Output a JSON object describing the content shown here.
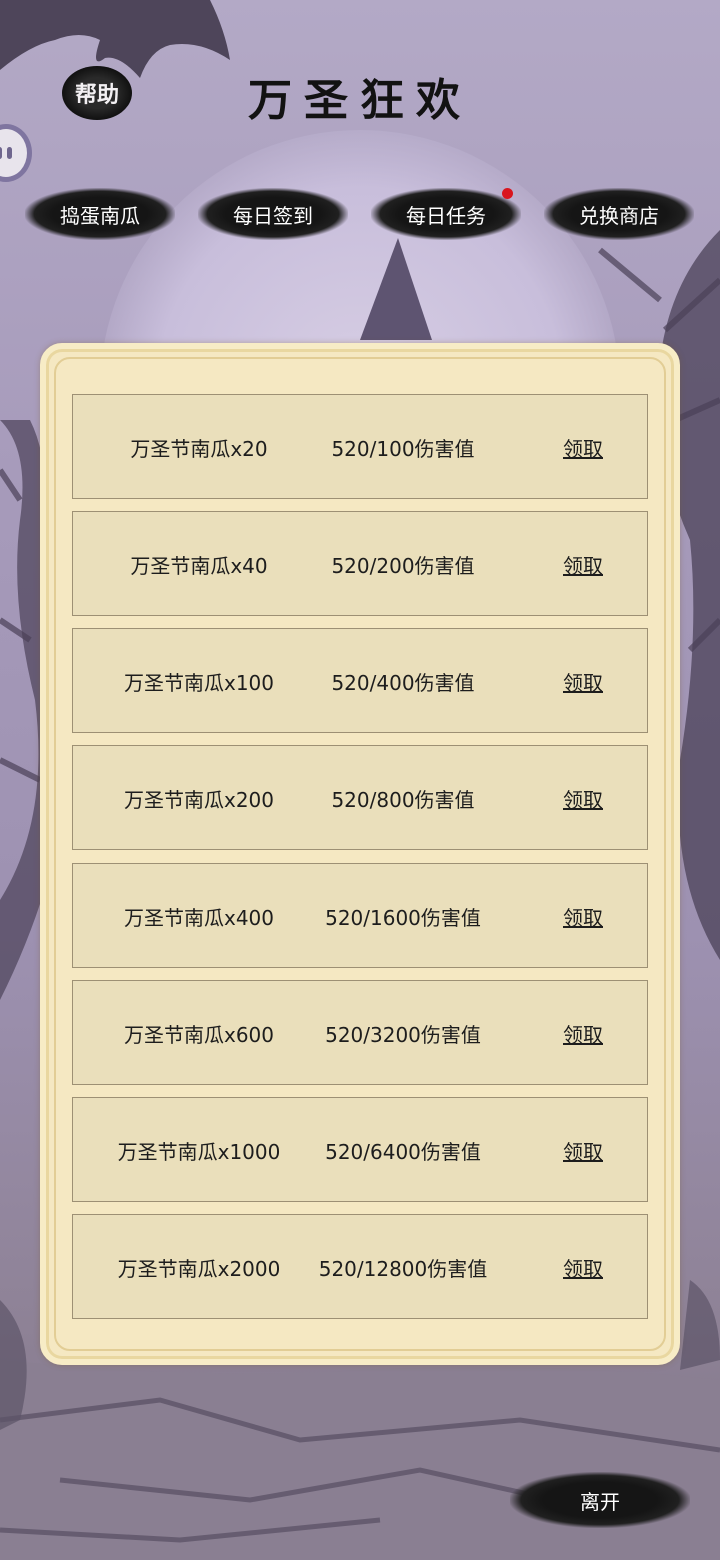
{
  "header": {
    "title": "万圣狂欢",
    "help_label": "帮助"
  },
  "tabs": [
    {
      "label": "捣蛋南瓜"
    },
    {
      "label": "每日签到"
    },
    {
      "label": "每日任务",
      "has_notification": true
    },
    {
      "label": "兑换商店"
    }
  ],
  "rewards": [
    {
      "name": "万圣节南瓜x20",
      "progress": "520/100伤害值",
      "action": "领取"
    },
    {
      "name": "万圣节南瓜x40",
      "progress": "520/200伤害值",
      "action": "领取"
    },
    {
      "name": "万圣节南瓜x100",
      "progress": "520/400伤害值",
      "action": "领取"
    },
    {
      "name": "万圣节南瓜x200",
      "progress": "520/800伤害值",
      "action": "领取"
    },
    {
      "name": "万圣节南瓜x400",
      "progress": "520/1600伤害值",
      "action": "领取"
    },
    {
      "name": "万圣节南瓜x600",
      "progress": "520/3200伤害值",
      "action": "领取"
    },
    {
      "name": "万圣节南瓜x1000",
      "progress": "520/6400伤害值",
      "action": "领取"
    },
    {
      "name": "万圣节南瓜x2000",
      "progress": "520/12800伤害值",
      "action": "领取"
    }
  ],
  "footer": {
    "leave_label": "离开"
  },
  "colors": {
    "panel": "#f5e8c2",
    "row": "#eadfbb",
    "notification_dot": "#d9151e",
    "background": "#a79bbb"
  }
}
